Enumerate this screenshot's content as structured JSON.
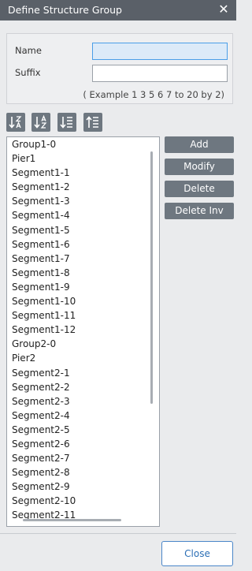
{
  "window": {
    "title": "Define Structure Group"
  },
  "form": {
    "name_label": "Name",
    "name_value": "",
    "suffix_label": "Suffix",
    "suffix_value": "",
    "example": "( Example 1 3 5 6 7 to 20 by 2)"
  },
  "sort_icons": [
    "sort-z-a-icon",
    "sort-a-z-icon",
    "sort-descending-icon",
    "sort-ascending-icon"
  ],
  "list": {
    "items": [
      "Group1-0",
      "Pier1",
      "Segment1-1",
      "Segment1-2",
      "Segment1-3",
      "Segment1-4",
      "Segment1-5",
      "Segment1-6",
      "Segment1-7",
      "Segment1-8",
      "Segment1-9",
      "Segment1-10",
      "Segment1-11",
      "Segment1-12",
      "Group2-0",
      "Pier2",
      "Segment2-1",
      "Segment2-2",
      "Segment2-3",
      "Segment2-4",
      "Segment2-5",
      "Segment2-6",
      "Segment2-7",
      "Segment2-8",
      "Segment2-9",
      "Segment2-10",
      "Segment2-11"
    ]
  },
  "actions": {
    "add": "Add",
    "modify": "Modify",
    "delete": "Delete",
    "delete_inv": "Delete Inv"
  },
  "footer": {
    "close": "Close"
  },
  "colors": {
    "titlebar": "#5a6068",
    "button": "#6e7780",
    "accent": "#4a86c8",
    "active_input": "#dceaf8"
  }
}
